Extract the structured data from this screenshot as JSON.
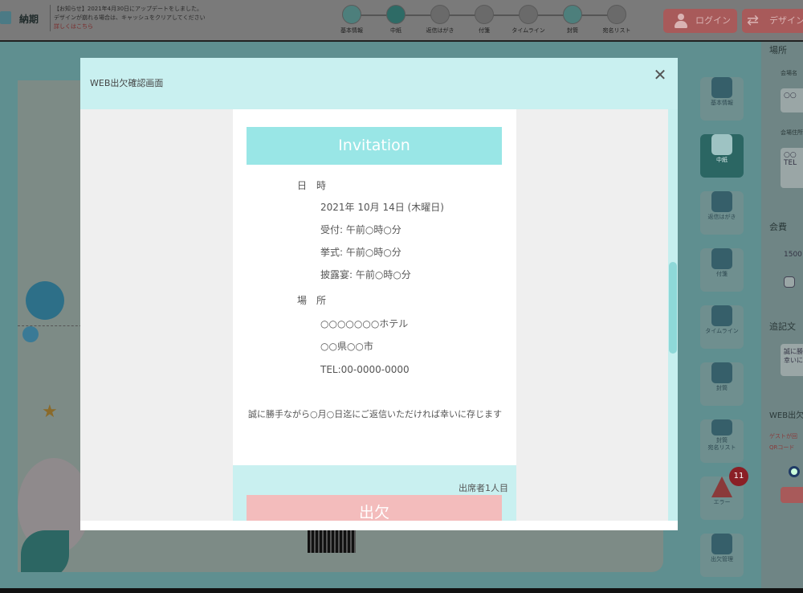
{
  "app": {
    "brand": "納期",
    "notice": {
      "line1": "【お知らせ】2021年4月30日にアップデートをしました。",
      "line2": "デザインが崩れる場合は、キャッシュをクリアしてください",
      "link": "詳しくはこちら"
    },
    "steps": [
      {
        "label": "基本情報",
        "state": "done"
      },
      {
        "label": "中紙",
        "state": "current"
      },
      {
        "label": "返信はがき",
        "state": "todo"
      },
      {
        "label": "付箋",
        "state": "todo"
      },
      {
        "label": "タイムライン",
        "state": "todo"
      },
      {
        "label": "封筒",
        "state": "done"
      },
      {
        "label": "宛名リスト",
        "state": "todo"
      }
    ],
    "login_button": "ログイン",
    "design_button": "デザイン変",
    "rail": [
      {
        "label": "基本情報"
      },
      {
        "label": "中紙"
      },
      {
        "label": "返信はがき"
      },
      {
        "label": "付箋"
      },
      {
        "label": "タイムライン"
      },
      {
        "label": "封筒"
      },
      {
        "label": "封筒\n宛名リスト"
      },
      {
        "label": "エラー",
        "badge": "11"
      },
      {
        "label": "出欠管理"
      }
    ],
    "panel": {
      "section_venue": "場所",
      "venue_name_label": "会場名",
      "venue_name_value": "○○",
      "venue_addr_label": "会場住所",
      "venue_addr_value": "○○",
      "venue_tel_value": "TEL",
      "section_fee": "会費",
      "fee_value": "1500",
      "section_note": "追記文",
      "note_value1": "誠に勝",
      "note_value2": "幸いに",
      "section_web": "WEB出欠",
      "web_note1": "ゲストが回",
      "web_note2": "QRコード"
    }
  },
  "modal": {
    "title": "WEB出欠確認画面",
    "close_icon": "close-icon",
    "invitation": {
      "title": "Invitation",
      "datetime_label": "日　時",
      "date": "2021年 10月 14日 (木曜日)",
      "reception": "受付:  午前○時○分",
      "ceremony": "挙式:  午前○時○分",
      "reception_party": "披露宴:  午前○時○分",
      "place_label": "場　所",
      "hotel": "○○○○○○○ホテル",
      "address": "○○県○○市",
      "tel": "TEL:00-0000-0000",
      "message": "誠に勝手ながら○月○日迄にご返信いただければ幸いに存じます"
    },
    "rsvp": {
      "attendee": "出席者1人目",
      "button": "出欠"
    }
  },
  "colors": {
    "modal_header": "#c9f0f0",
    "invitation_title_bg": "#99e6e6",
    "rsvp_button": "#f3bcbc"
  }
}
